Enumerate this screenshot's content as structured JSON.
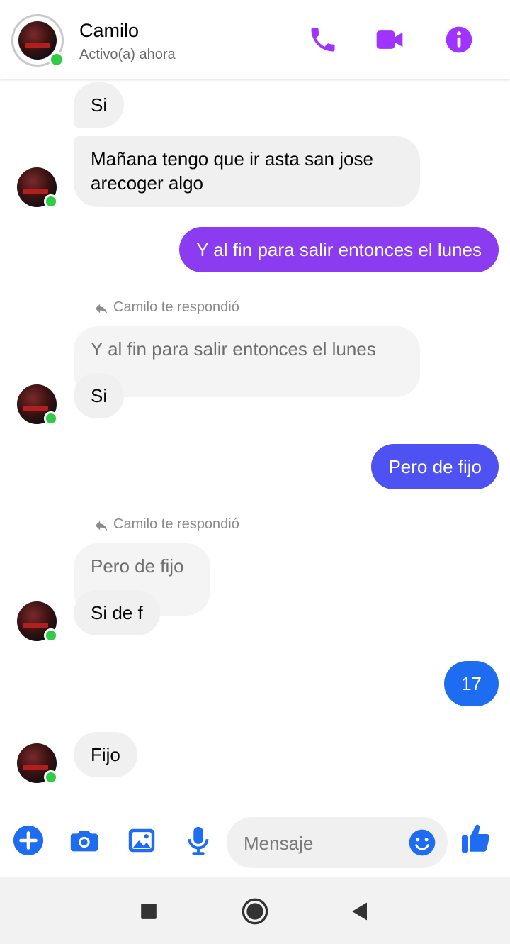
{
  "header": {
    "contact_name": "Camilo",
    "status": "Activo(a) ahora",
    "icons": [
      "phone-icon",
      "video-camera-icon",
      "info-icon"
    ]
  },
  "colors": {
    "accent": "#a033ff",
    "messenger_blue": "#1d6cf2",
    "online": "#31cc46",
    "bubble_incoming": "#f0f0f0"
  },
  "messages": [
    {
      "from": "Camilo",
      "text": "Si"
    },
    {
      "from": "Camilo",
      "text": "Mañana tengo que ir asta san jose",
      "text2": "arecoger algo"
    },
    {
      "from": "me",
      "text": "Y al fin para salir entonces el lunes"
    },
    {
      "from": "Camilo",
      "reply_note": "Camilo te respondió",
      "quoted": "Y al fin para salir entonces el lunes",
      "text": "Si"
    },
    {
      "from": "me",
      "text": "Pero de fijo"
    },
    {
      "from": "Camilo",
      "reply_note": "Camilo te respondió",
      "quoted": "Pero de fijo",
      "text": "Si de f"
    },
    {
      "from": "me",
      "text": "17"
    },
    {
      "from": "Camilo",
      "text": "Fijo"
    }
  ],
  "composer": {
    "placeholder": "Mensaje",
    "icons": [
      "plus-icon",
      "camera-icon",
      "image-icon",
      "microphone-icon",
      "emoji-icon",
      "thumbs-up-icon"
    ]
  },
  "navbar": {
    "icons": [
      "recent-apps-icon",
      "home-icon",
      "back-icon"
    ]
  }
}
